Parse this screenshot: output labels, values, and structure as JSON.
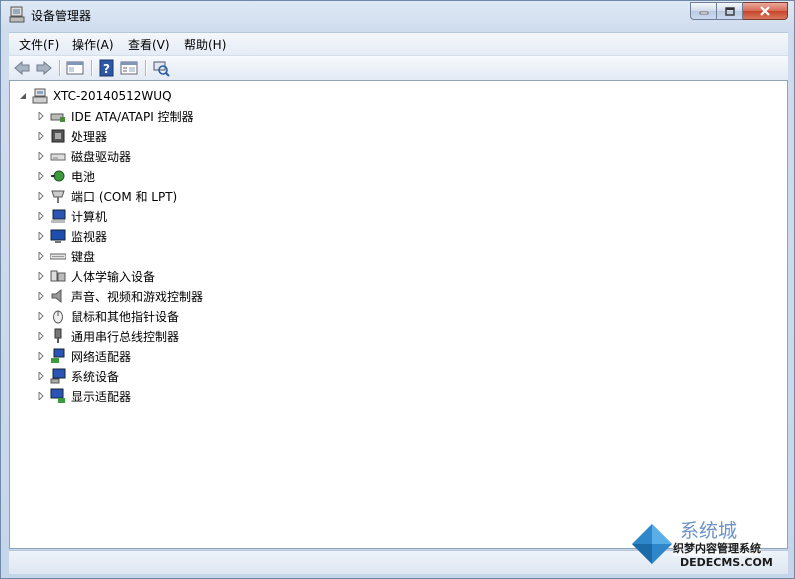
{
  "window": {
    "title": "设备管理器"
  },
  "caption_buttons": [
    "minimize-icon",
    "maximize-icon",
    "close-icon"
  ],
  "menu": [
    "文件(F)",
    "操作(A)",
    "查看(V)",
    "帮助(H)"
  ],
  "toolbar": [
    "back-icon",
    "forward-icon",
    "show-hide-tree-icon",
    "help-icon",
    "properties-icon",
    "scan-hardware-icon"
  ],
  "tree": {
    "root": "XTC-20140512WUQ",
    "items": [
      {
        "label": "IDE ATA/ATAPI 控制器",
        "icon": "ide-controller-icon"
      },
      {
        "label": "处理器",
        "icon": "processor-icon"
      },
      {
        "label": "磁盘驱动器",
        "icon": "disk-drive-icon"
      },
      {
        "label": "电池",
        "icon": "battery-icon"
      },
      {
        "label": "端口 (COM 和 LPT)",
        "icon": "port-icon"
      },
      {
        "label": "计算机",
        "icon": "computer-icon"
      },
      {
        "label": "监视器",
        "icon": "monitor-icon"
      },
      {
        "label": "键盘",
        "icon": "keyboard-icon"
      },
      {
        "label": "人体学输入设备",
        "icon": "hid-icon"
      },
      {
        "label": "声音、视频和游戏控制器",
        "icon": "sound-icon"
      },
      {
        "label": "鼠标和其他指针设备",
        "icon": "mouse-icon"
      },
      {
        "label": "通用串行总线控制器",
        "icon": "usb-icon"
      },
      {
        "label": "网络适配器",
        "icon": "network-adapter-icon"
      },
      {
        "label": "系统设备",
        "icon": "system-device-icon"
      },
      {
        "label": "显示适配器",
        "icon": "display-adapter-icon"
      }
    ]
  },
  "watermark": {
    "line1": "系统城",
    "line2": "织梦内容管理系统",
    "line3": "DEDECMS.COM"
  }
}
